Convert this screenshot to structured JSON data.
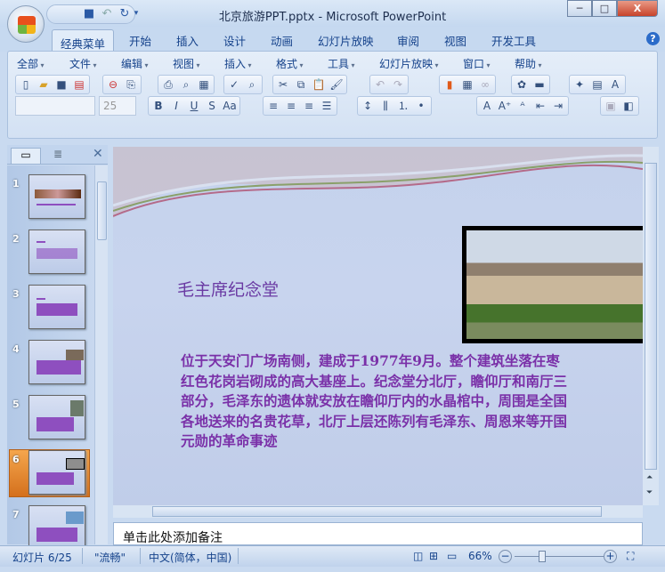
{
  "window": {
    "title": "北京旅游PPT.pptx - Microsoft PowerPoint",
    "minimize": "─",
    "maximize": "□",
    "close": "X"
  },
  "ribbon": {
    "tabs": [
      "经典菜单",
      "开始",
      "插入",
      "设计",
      "动画",
      "幻灯片放映",
      "审阅",
      "视图",
      "开发工具"
    ],
    "active_tab": "经典菜单",
    "menus": [
      "全部",
      "文件",
      "编辑",
      "视图",
      "插入",
      "格式",
      "工具",
      "幻灯片放映",
      "窗口",
      "帮助"
    ],
    "font_name": "",
    "font_size": "25"
  },
  "slides_panel": {
    "numbers": [
      "1",
      "2",
      "3",
      "4",
      "5",
      "6",
      "7"
    ],
    "selected": "6"
  },
  "slide": {
    "title": "毛主席纪念堂",
    "body": "位于天安门广场南侧，建成于1977年9月。整个建筑坐落在枣红色花岗岩砌成的高大基座上。纪念堂分北厅，瞻仰厅和南厅三部分，毛泽东的遗体就安放在瞻仰厅内的水晶棺中，周围是全国各地送来的名贵花草，北厅上层还陈列有毛泽东、周恩来等开国元勋的革命事迹"
  },
  "notes": {
    "placeholder": "单击此处添加备注"
  },
  "status": {
    "slide": "幻灯片 6/25",
    "theme": "\"流畅\"",
    "language": "中文(简体，中国)",
    "zoom": "66%",
    "zoom_value": 66
  },
  "colors": {
    "accent": "#15428b",
    "slide_text": "#7a30a8",
    "selected_thumb": "#e8882e"
  }
}
